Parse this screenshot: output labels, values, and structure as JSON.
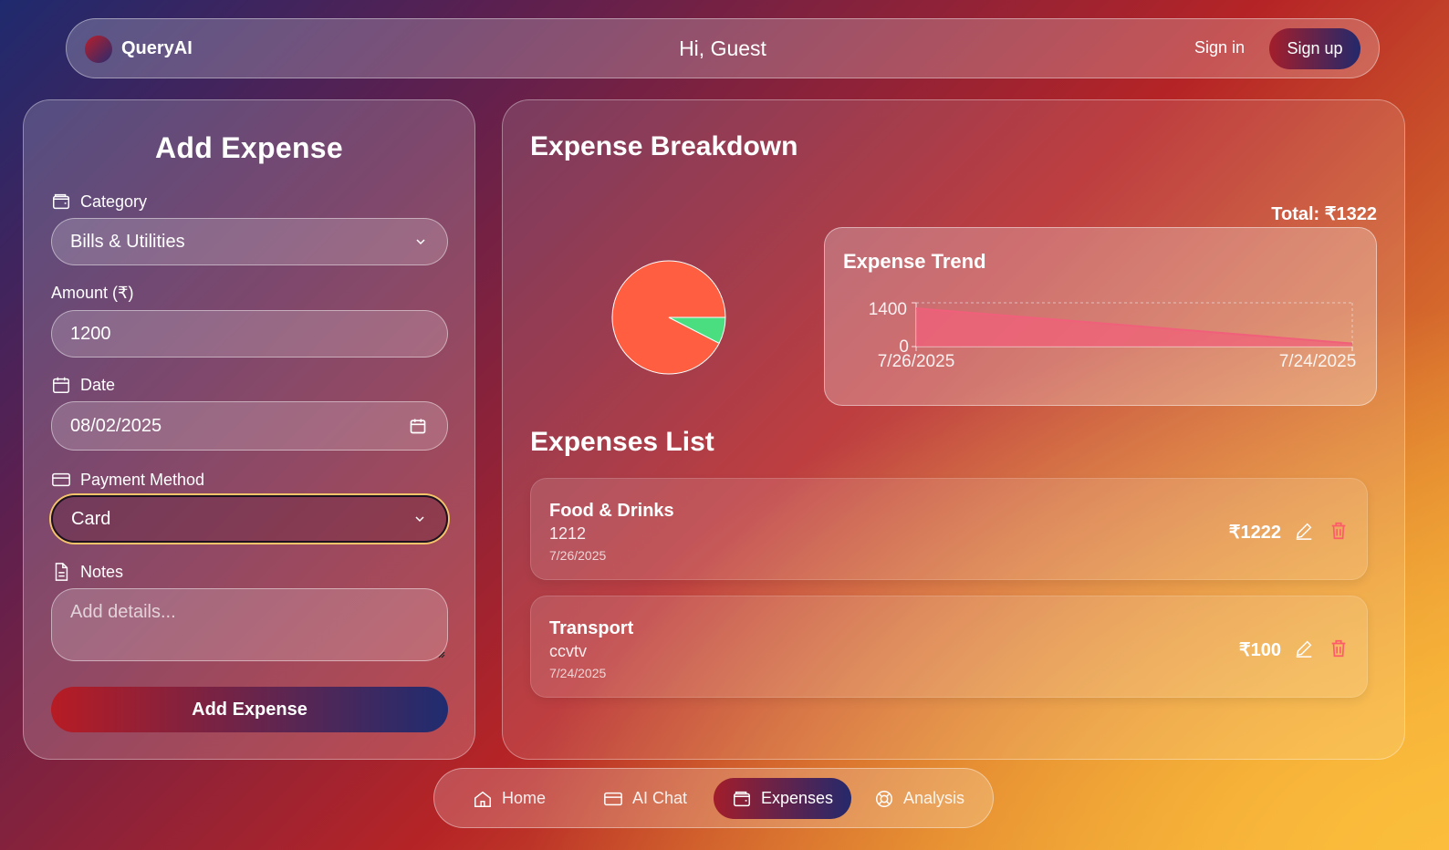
{
  "header": {
    "app_name": "QueryAI",
    "greeting": "Hi, Guest",
    "signin_label": "Sign in",
    "signup_label": "Sign up"
  },
  "form": {
    "title": "Add Expense",
    "category_label": "Category",
    "category_value": "Bills & Utilities",
    "amount_label": "Amount (₹)",
    "amount_value": "1200",
    "date_label": "Date",
    "date_value": "08/02/2025",
    "payment_label": "Payment Method",
    "payment_value": "Card",
    "notes_label": "Notes",
    "notes_placeholder": "Add details...",
    "submit_label": "Add Expense"
  },
  "breakdown": {
    "title": "Expense Breakdown",
    "total": "Total: ₹1322"
  },
  "trend": {
    "title": "Expense Trend",
    "ytick_top": "1400",
    "ytick_bottom": "0",
    "xtick_left": "7/26/2025",
    "xtick_right": "7/24/2025"
  },
  "chart_data": [
    {
      "type": "pie",
      "values": [
        1222,
        100
      ],
      "colors": [
        "#ff5e40",
        "#4ade80"
      ]
    },
    {
      "type": "area",
      "title": "Expense Trend",
      "x": [
        "7/26/2025",
        "7/24/2025"
      ],
      "values": [
        1222,
        100
      ],
      "ylim": [
        0,
        1400
      ],
      "color": "#f0607a"
    }
  ],
  "list": {
    "title": "Expenses List",
    "items": [
      {
        "category": "Food & Drinks",
        "note": "1212",
        "date": "7/26/2025",
        "amount": "₹1222"
      },
      {
        "category": "Transport",
        "note": "ccvtv",
        "date": "7/24/2025",
        "amount": "₹100"
      }
    ]
  },
  "nav": {
    "home": "Home",
    "chat": "AI Chat",
    "expenses": "Expenses",
    "analysis": "Analysis"
  },
  "colors": {
    "accent_red": "#b71c24",
    "accent_navy": "#1f2c70",
    "delete_icon": "#ff5a6a"
  }
}
